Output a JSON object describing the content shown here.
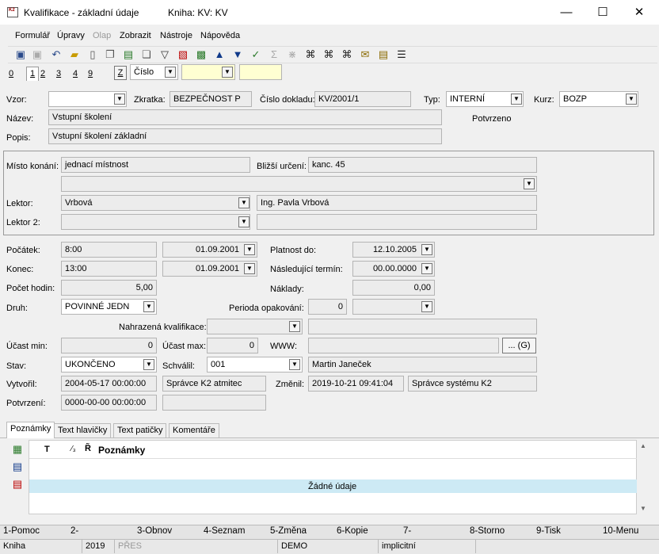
{
  "window": {
    "app_icon_text": "K2",
    "title": "Kvalifikace - základní údaje",
    "book": "Kniha: KV: KV",
    "min": "—",
    "max": "☐",
    "close": "✕"
  },
  "menu": [
    "Formulář",
    "Úpravy",
    "Olap",
    "Zobrazit",
    "Nástroje",
    "Nápověda"
  ],
  "toolbar_icons": [
    "save-icon",
    "save-all-icon",
    "undo-icon",
    "open-folder-icon",
    "new-document-icon",
    "copy-icon",
    "lock-icon",
    "book-icon",
    "filter-icon",
    "remove-filter-icon",
    "books-icon",
    "arrow-up-icon",
    "arrow-down-icon",
    "check-filter-icon",
    "sum-icon",
    "clear-filter-icon",
    "binoculars-icon",
    "find-next-icon",
    "find-prev-icon",
    "mail-icon",
    "notes-icon",
    "menu-icon"
  ],
  "pagetabs": [
    "0",
    "1",
    "2",
    "3",
    "4",
    "9"
  ],
  "sortbtn": "Z",
  "sortfield": "Číslo",
  "form": {
    "vzor_label": "Vzor:",
    "vzor": "",
    "zkratka_label": "Zkratka:",
    "zkratka": "BEZPEČNOST P",
    "cislo_label": "Číslo dokladu:",
    "cislo": "KV/2001/1",
    "typ_label": "Typ:",
    "typ": "INTERNÍ",
    "kurz_label": "Kurz:",
    "kurz": "BOZP",
    "nazev_label": "Název:",
    "nazev": "Vstupní školení",
    "potvrzeno": "Potvrzeno",
    "popis_label": "Popis:",
    "popis": "Vstupní školení základní",
    "misto_label": "Místo konání:",
    "misto": "jednací místnost",
    "blizsi_label": "Bližší určení:",
    "blizsi": "kanc. 45",
    "lektor_label": "Lektor:",
    "lektor": "Vrbová",
    "lektor_name": "Ing. Pavla Vrbová",
    "lektor2_label": "Lektor 2:",
    "pocatek_label": "Počátek:",
    "pocatek_time": "8:00",
    "pocatek_date": "01.09.2001",
    "platnost_label": "Platnost do:",
    "platnost": "12.10.2005",
    "konec_label": "Konec:",
    "konec_time": "13:00",
    "konec_date": "01.09.2001",
    "nasl_label": "Následující termín:",
    "nasl": "00.00.0000",
    "hodin_label": "Počet hodin:",
    "hodin": "5,00",
    "naklady_label": "Náklady:",
    "naklady": "0,00",
    "druh_label": "Druh:",
    "druh": "POVINNÉ JEDN",
    "perioda_label": "Perioda opakování:",
    "perioda": "0",
    "nahrazena_label": "Nahrazená kvalifikace:",
    "ucastmin_label": "Účast min:",
    "ucastmin": "0",
    "ucastmax_label": "Účast max:",
    "ucastmax": "0",
    "www_label": "WWW:",
    "www_btn": "... (G)",
    "stav_label": "Stav:",
    "stav": "UKONČENO",
    "schvalil_label": "Schválil:",
    "schvalil": "001",
    "schvalil_name": "Martin Janeček",
    "vytvoril_label": "Vytvořil:",
    "vytvoril": "2004-05-17 00:00:00",
    "vytvoril_user": "Správce K2 atmitec",
    "zmenil_label": "Změnil:",
    "zmenil": "2019-10-21 09:41:04",
    "zmenil_user": "Správce systému K2",
    "potvrzeni_label": "Potvrzení:",
    "potvrzeni": "0000-00-00 00:00:00"
  },
  "bottom_tabs": [
    "Poznámky",
    "Text hlavičky",
    "Text patičky",
    "Komentáře"
  ],
  "grid": {
    "col_t": "T",
    "col_num": "⁄₃",
    "col_icon": "R̃",
    "col_title": "Poznámky",
    "empty": "Žádné údaje"
  },
  "fkeys": [
    "1-Pomoc",
    "2-",
    "3-Obnov",
    "4-Seznam",
    "5-Změna",
    "6-Kopie",
    "7-",
    "8-Storno",
    "9-Tisk",
    "10-Menu"
  ],
  "status": {
    "kniha": "Kniha",
    "year": "2019",
    "pres": "PŘES",
    "demo": "DEMO",
    "impl": "implicitní"
  }
}
